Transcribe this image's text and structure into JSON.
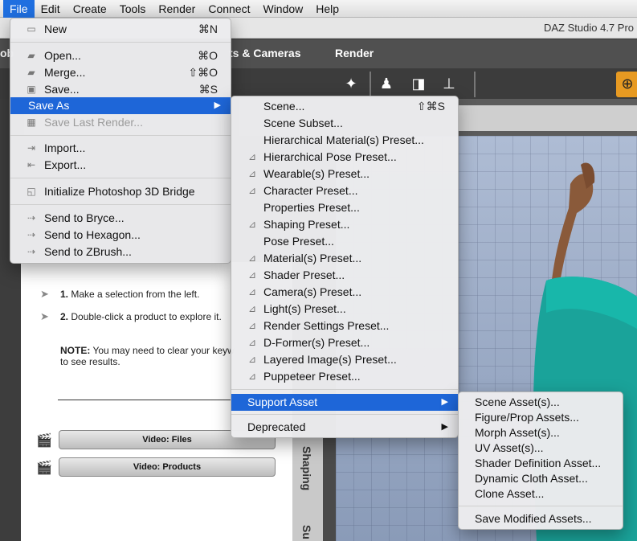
{
  "menubar": {
    "items": [
      "File",
      "Edit",
      "Create",
      "Tools",
      "Render",
      "Connect",
      "Window",
      "Help"
    ]
  },
  "app": {
    "title": "DAZ Studio 4.7 Pro"
  },
  "tabs": {
    "partial_left": "ob",
    "lights_cameras": "ts & Cameras",
    "render": "Render"
  },
  "content": {
    "step1_num": "1.",
    "step1_text": "Make a selection from the left.",
    "step2_num": "2.",
    "step2_text": "Double-click a product to explore it.",
    "note_label": "NOTE:",
    "note_text": "You may need to clear your keyw",
    "note_text2": "to see results.",
    "video_files": "Video: Files",
    "video_products": "Video: Products"
  },
  "side_tabs": {
    "shaping": "Shaping",
    "surfaces": "Su"
  },
  "file_menu": {
    "new": {
      "label": "New",
      "shortcut": "⌘N"
    },
    "open": {
      "label": "Open...",
      "shortcut": "⌘O"
    },
    "merge": {
      "label": "Merge...",
      "shortcut": "⇧⌘O"
    },
    "save": {
      "label": "Save...",
      "shortcut": "⌘S"
    },
    "save_as": {
      "label": "Save As"
    },
    "save_last_render": {
      "label": "Save Last Render..."
    },
    "import": {
      "label": "Import..."
    },
    "export": {
      "label": "Export..."
    },
    "photoshop": {
      "label": "Initialize Photoshop 3D Bridge"
    },
    "bryce": {
      "label": "Send to Bryce..."
    },
    "hexagon": {
      "label": "Send to Hexagon..."
    },
    "zbrush": {
      "label": "Send to ZBrush..."
    }
  },
  "save_as_menu": {
    "scene": {
      "label": "Scene...",
      "shortcut": "⇧⌘S"
    },
    "scene_subset": "Scene Subset...",
    "hierarchical_material": "Hierarchical Material(s) Preset...",
    "hierarchical_pose": "Hierarchical Pose Preset...",
    "wearables": "Wearable(s) Preset...",
    "character": "Character Preset...",
    "properties": "Properties Preset...",
    "shaping": "Shaping Preset...",
    "pose": "Pose Preset...",
    "materials": "Material(s) Preset...",
    "shader": "Shader Preset...",
    "cameras": "Camera(s) Preset...",
    "lights": "Light(s) Preset...",
    "render_settings": "Render Settings Preset...",
    "dformers": "D-Former(s) Preset...",
    "layered_images": "Layered Image(s) Preset...",
    "puppeteer": "Puppeteer Preset...",
    "support_asset": "Support Asset",
    "deprecated": "Deprecated"
  },
  "support_asset_menu": {
    "scene_assets": "Scene Asset(s)...",
    "figure_prop": "Figure/Prop Assets...",
    "morph": "Morph Asset(s)...",
    "uv": "UV Asset(s)...",
    "shader_definition": "Shader Definition Asset...",
    "dynamic_cloth": "Dynamic Cloth Asset...",
    "clone": "Clone Asset...",
    "save_modified": "Save Modified Assets..."
  },
  "colors": {
    "highlight": "#1e66d8",
    "menubar_active": "#1f6fe0",
    "toolbar_accent": "#e79a22"
  }
}
